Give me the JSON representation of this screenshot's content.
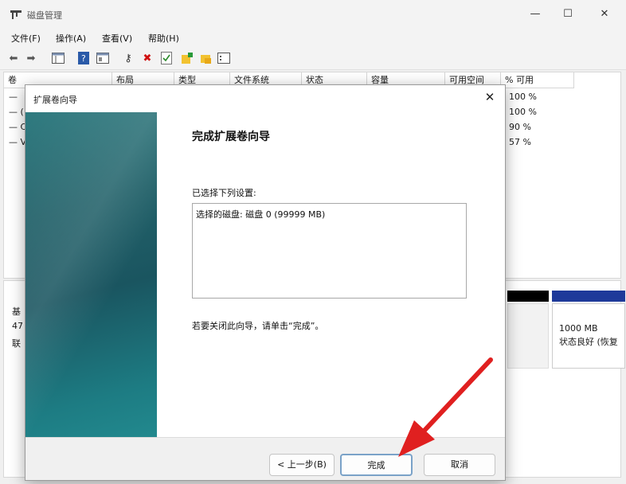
{
  "window": {
    "title": "磁盘管理",
    "controls": {
      "minimize": "—",
      "maximize": "☐",
      "close": "✕"
    }
  },
  "menu": [
    "文件(F)",
    "操作(A)",
    "查看(V)",
    "帮助(H)"
  ],
  "toolbar": {
    "icons": [
      "back-arrow-icon",
      "forward-arrow-icon",
      "console-tree-icon",
      "help-icon",
      "properties-icon",
      "key-icon",
      "delete-icon",
      "checklist-icon",
      "folder-add-icon",
      "folder-open-icon",
      "list-view-icon"
    ]
  },
  "volume_list": {
    "columns": [
      "卷",
      "布局",
      "类型",
      "文件系统",
      "状态",
      "容量",
      "可用空间",
      "% 可用"
    ],
    "rows": [
      {
        "marker": "—",
        "pct": "100 %"
      },
      {
        "marker": "— (",
        "pct": "100 %"
      },
      {
        "marker": "— C",
        "pct": "90 %"
      },
      {
        "marker": "— V",
        "pct": "57 %"
      }
    ]
  },
  "disk_panel": {
    "left_lines": [
      "基",
      "47",
      "联"
    ],
    "partition": {
      "size": "1000 MB",
      "status": "状态良好 (恢复"
    }
  },
  "wizard": {
    "title": "扩展卷向导",
    "heading": "完成扩展卷向导",
    "settings_label": "已选择下列设置:",
    "settings_text": "选择的磁盘: 磁盘 0 (99999 MB)",
    "finish_hint": "若要关闭此向导，请单击“完成”。",
    "buttons": {
      "back": "< 上一步(B)",
      "finish": "完成",
      "cancel": "取消"
    },
    "close": "✕"
  },
  "colors": {
    "arrow": "#e02020",
    "banner": "#1d6a72",
    "partition_blue": "#1e3a9a"
  }
}
